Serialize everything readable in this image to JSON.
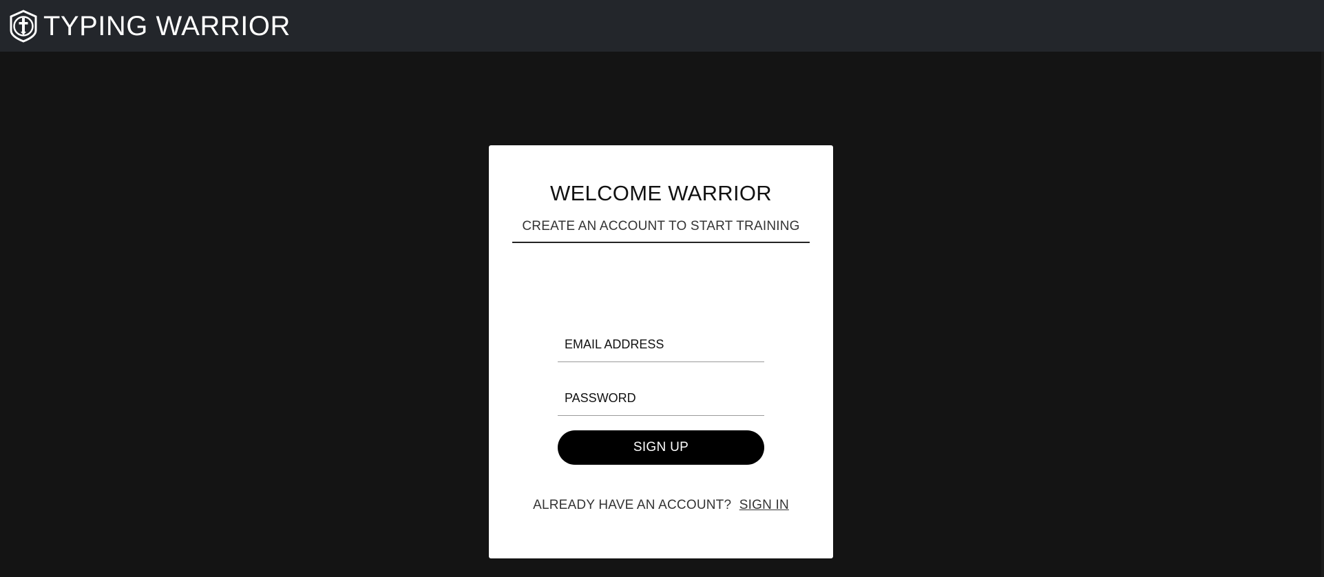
{
  "header": {
    "brand_name": "TYPING WARRIOR",
    "logo_icon": "shield-dagger-icon",
    "background_color": "#23262b"
  },
  "page": {
    "background_color": "#141414"
  },
  "signup_card": {
    "title": "WELCOME WARRIOR",
    "subtitle": "CREATE AN ACCOUNT TO START TRAINING",
    "email_field": {
      "placeholder": "EMAIL ADDRESS",
      "value": ""
    },
    "password_field": {
      "placeholder": "PASSWORD",
      "value": ""
    },
    "signup_button_label": "SIGN UP",
    "signin_prompt": "ALREADY HAVE AN ACCOUNT?",
    "signin_link_label": "SIGN IN"
  }
}
